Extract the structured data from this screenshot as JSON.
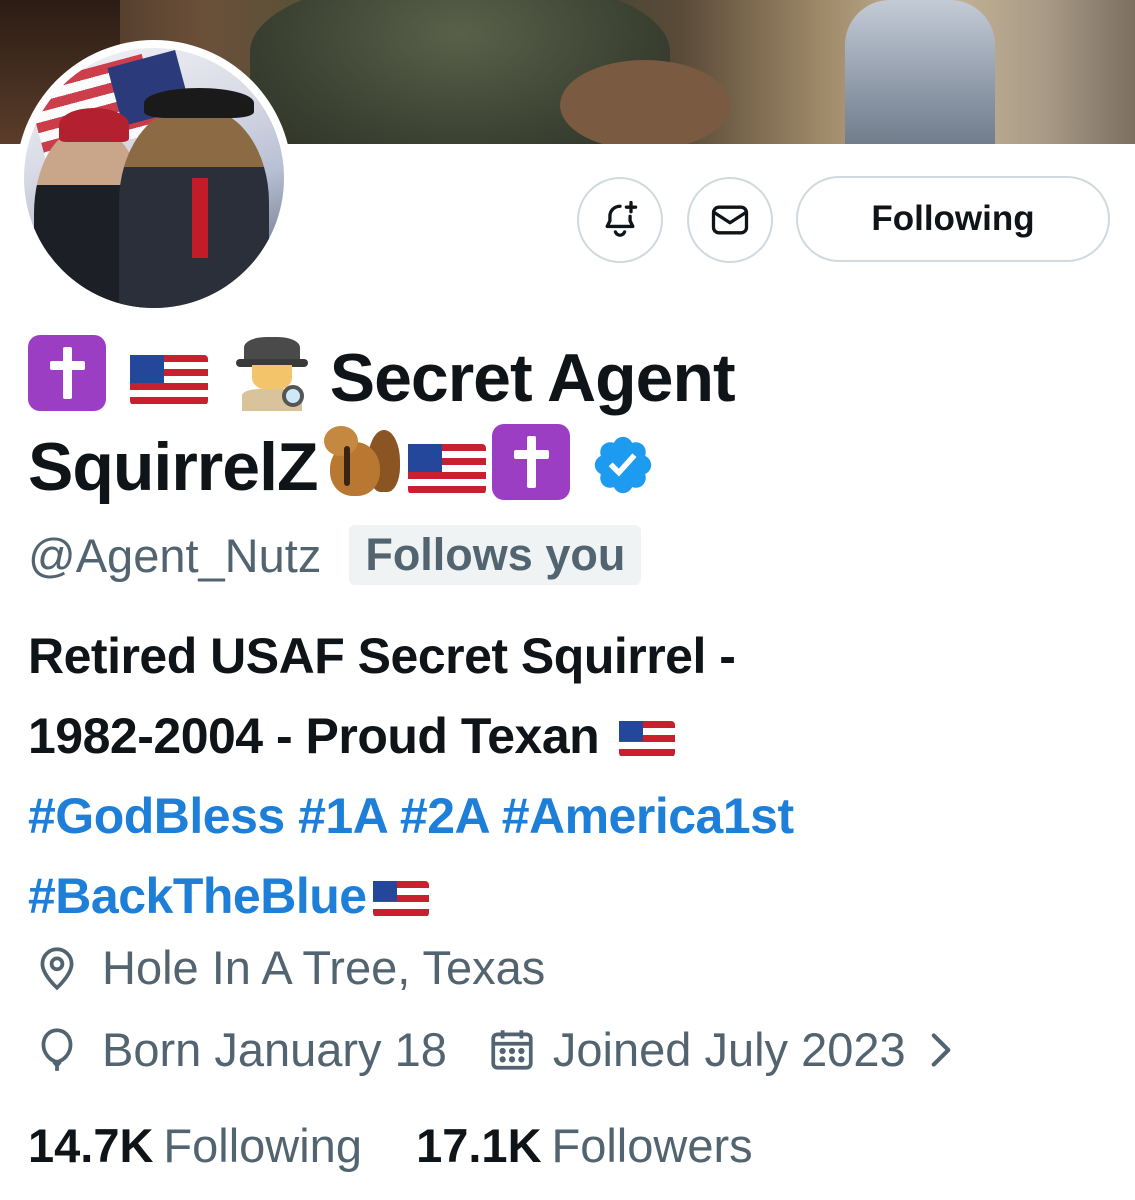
{
  "profile": {
    "display_name": "Secret Agent SquirrelZ",
    "display_name_line1": "Secret Agent",
    "display_name_line2": "SquirrelZ",
    "handle": "@Agent_Nutz",
    "follows_you_badge": "Follows you",
    "verified": true
  },
  "actions": {
    "notify_icon": "bell-plus-icon",
    "message_icon": "envelope-icon",
    "following_label": "Following"
  },
  "bio": {
    "line1": "Retired USAF Secret Squirrel -",
    "line2": "1982-2004 - Proud Texan",
    "hashtags": [
      "#GodBless",
      "#1A",
      "#2A",
      "#America1st",
      "#BackTheBlue"
    ]
  },
  "meta": {
    "location": "Hole In A Tree, Texas",
    "birthday": "Born January 18",
    "joined": "Joined July 2023"
  },
  "stats": {
    "following_count": "14.7K",
    "following_label": "Following",
    "followers_count": "17.1K",
    "followers_label": "Followers"
  },
  "colors": {
    "accent": "#1d9bf0",
    "hashtag": "#1d7fd8",
    "muted": "#536471",
    "text": "#0f1419",
    "border": "#cfd9de"
  }
}
